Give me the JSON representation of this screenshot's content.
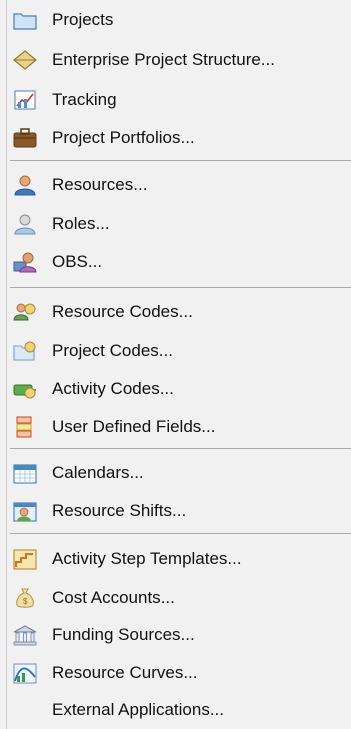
{
  "menu": {
    "items": [
      {
        "label": "Projects"
      },
      {
        "label": "Enterprise Project Structure..."
      },
      {
        "label": "Tracking"
      },
      {
        "label": "Project Portfolios..."
      },
      {
        "label": "Resources..."
      },
      {
        "label": "Roles..."
      },
      {
        "label": "OBS..."
      },
      {
        "label": "Resource Codes..."
      },
      {
        "label": "Project Codes..."
      },
      {
        "label": "Activity Codes..."
      },
      {
        "label": "User Defined Fields..."
      },
      {
        "label": "Calendars..."
      },
      {
        "label": "Resource Shifts..."
      },
      {
        "label": "Activity Step Templates..."
      },
      {
        "label": "Cost Accounts..."
      },
      {
        "label": "Funding Sources..."
      },
      {
        "label": "Resource Curves..."
      },
      {
        "label": "External Applications..."
      }
    ]
  }
}
